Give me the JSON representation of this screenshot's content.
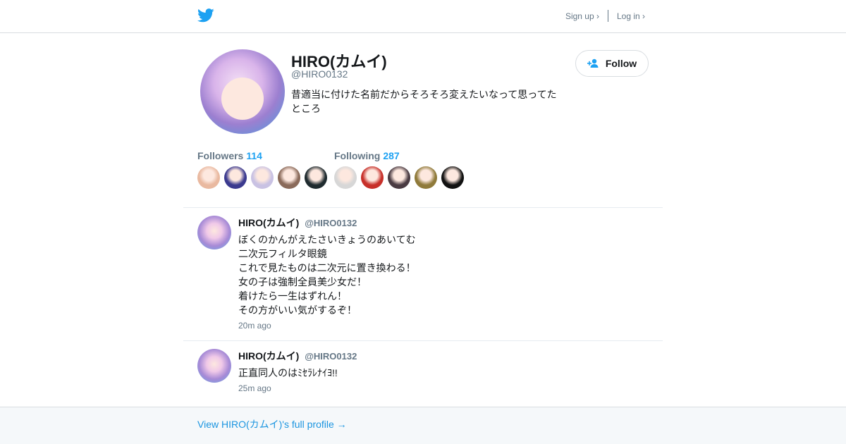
{
  "header": {
    "logo": "twitter-bird-icon",
    "signup_label": "Sign up ›",
    "login_label": "Log in ›"
  },
  "profile": {
    "name": "HIRO(カムイ)",
    "handle": "@HIRO0132",
    "bio": "昔適当に付けた名前だからそろそろ変えたいなって思ってたところ",
    "follow_label": "Follow"
  },
  "stats": {
    "followers_label": "Followers",
    "followers_count": "114",
    "following_label": "Following",
    "following_count": "287",
    "follower_faces": [
      "#e9b9a0",
      "#3b3a8f",
      "#c9c2e3",
      "#8a6a5a",
      "#1f2b2f"
    ],
    "following_faces": [
      "#d7d7d7",
      "#c7302a",
      "#4a3b42",
      "#8f7a3a",
      "#111111"
    ]
  },
  "tweets": [
    {
      "name": "HIRO(カムイ)",
      "handle": "@HIRO0132",
      "lines": [
        "ぼくのかんがえたさいきょうのあいてむ",
        "二次元フィルタ眼鏡",
        "これで見たものは二次元に置き換わる！",
        "女の子は強制全員美少女だ！",
        "着けたら一生はずれん！",
        "その方がいい気がするぞ！"
      ],
      "time": "20m ago"
    },
    {
      "name": "HIRO(カムイ)",
      "handle": "@HIRO0132",
      "lines": [
        "正直同人のはﾐｾﾗﾚﾅｲﾖ!!"
      ],
      "time": "25m ago"
    }
  ],
  "footer": {
    "link": "View HIRO(カムイ)'s full profile →"
  },
  "colors": {
    "accent": "#1da1f2",
    "link": "#1b95e0",
    "muted": "#657786"
  }
}
